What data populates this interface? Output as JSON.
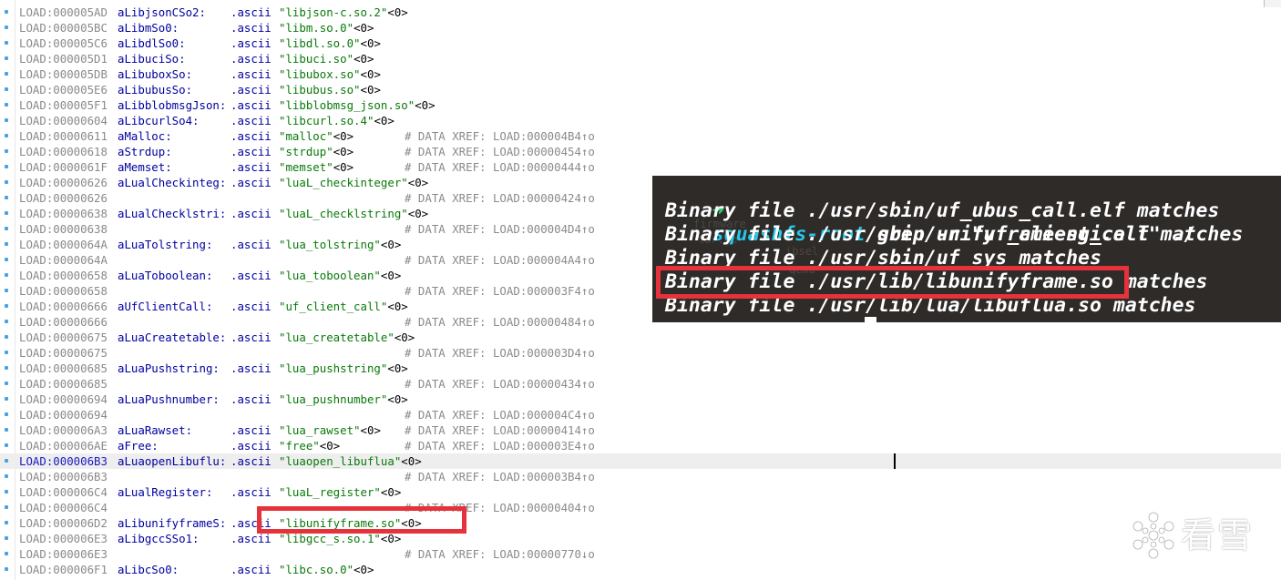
{
  "disassembly": {
    "lines": [
      {
        "addr": "LOAD:000005AD",
        "label": "aLibjsonCSo2:",
        "directive": ".ascii",
        "value": "\"libjson-c.so.2\"",
        "nul": "<0>",
        "comment": ""
      },
      {
        "addr": "LOAD:000005BC",
        "label": "aLibmSo0:",
        "directive": ".ascii",
        "value": "\"libm.so.0\"",
        "nul": "<0>",
        "comment": ""
      },
      {
        "addr": "LOAD:000005C6",
        "label": "aLibdlSo0:",
        "directive": ".ascii",
        "value": "\"libdl.so.0\"",
        "nul": "<0>",
        "comment": ""
      },
      {
        "addr": "LOAD:000005D1",
        "label": "aLibuciSo:",
        "directive": ".ascii",
        "value": "\"libuci.so\"",
        "nul": "<0>",
        "comment": ""
      },
      {
        "addr": "LOAD:000005DB",
        "label": "aLibuboxSo:",
        "directive": ".ascii",
        "value": "\"libubox.so\"",
        "nul": "<0>",
        "comment": ""
      },
      {
        "addr": "LOAD:000005E6",
        "label": "aLibubusSo:",
        "directive": ".ascii",
        "value": "\"libubus.so\"",
        "nul": "<0>",
        "comment": ""
      },
      {
        "addr": "LOAD:000005F1",
        "label": "aLibblobmsgJson:",
        "directive": ".ascii",
        "value": "\"libblobmsg_json.so\"",
        "nul": "<0>",
        "comment": ""
      },
      {
        "addr": "LOAD:00000604",
        "label": "aLibcurlSo4:",
        "directive": ".ascii",
        "value": "\"libcurl.so.4\"",
        "nul": "<0>",
        "comment": ""
      },
      {
        "addr": "LOAD:00000611",
        "label": "aMalloc:",
        "directive": ".ascii",
        "value": "\"malloc\"",
        "nul": "<0>",
        "comment": "# DATA XREF: LOAD:000004B4↑o"
      },
      {
        "addr": "LOAD:00000618",
        "label": "aStrdup:",
        "directive": ".ascii",
        "value": "\"strdup\"",
        "nul": "<0>",
        "comment": "# DATA XREF: LOAD:00000454↑o"
      },
      {
        "addr": "LOAD:0000061F",
        "label": "aMemset:",
        "directive": ".ascii",
        "value": "\"memset\"",
        "nul": "<0>",
        "comment": "# DATA XREF: LOAD:00000444↑o"
      },
      {
        "addr": "LOAD:00000626",
        "label": "aLualCheckinteg:",
        "directive": ".ascii",
        "value": "\"luaL_checkinteger\"",
        "nul": "<0>",
        "comment": ""
      },
      {
        "addr": "LOAD:00000626",
        "label": "",
        "directive": "",
        "value": "",
        "nul": "",
        "comment": "# DATA XREF: LOAD:00000424↑o"
      },
      {
        "addr": "LOAD:00000638",
        "label": "aLualChecklstri:",
        "directive": ".ascii",
        "value": "\"luaL_checklstring\"",
        "nul": "<0>",
        "comment": ""
      },
      {
        "addr": "LOAD:00000638",
        "label": "",
        "directive": "",
        "value": "",
        "nul": "",
        "comment": "# DATA XREF: LOAD:000004D4↑o"
      },
      {
        "addr": "LOAD:0000064A",
        "label": "aLuaTolstring:",
        "directive": ".ascii",
        "value": "\"lua_tolstring\"",
        "nul": "<0>",
        "comment": ""
      },
      {
        "addr": "LOAD:0000064A",
        "label": "",
        "directive": "",
        "value": "",
        "nul": "",
        "comment": "# DATA XREF: LOAD:000004A4↑o"
      },
      {
        "addr": "LOAD:00000658",
        "label": "aLuaToboolean:",
        "directive": ".ascii",
        "value": "\"lua_toboolean\"",
        "nul": "<0>",
        "comment": ""
      },
      {
        "addr": "LOAD:00000658",
        "label": "",
        "directive": "",
        "value": "",
        "nul": "",
        "comment": "# DATA XREF: LOAD:000003F4↑o"
      },
      {
        "addr": "LOAD:00000666",
        "label": "aUfClientCall:",
        "directive": ".ascii",
        "value": "\"uf_client_call\"",
        "nul": "<0>",
        "comment": ""
      },
      {
        "addr": "LOAD:00000666",
        "label": "",
        "directive": "",
        "value": "",
        "nul": "",
        "comment": "# DATA XREF: LOAD:00000484↑o"
      },
      {
        "addr": "LOAD:00000675",
        "label": "aLuaCreatetable:",
        "directive": ".ascii",
        "value": "\"lua_createtable\"",
        "nul": "<0>",
        "comment": ""
      },
      {
        "addr": "LOAD:00000675",
        "label": "",
        "directive": "",
        "value": "",
        "nul": "",
        "comment": "# DATA XREF: LOAD:000003D4↑o"
      },
      {
        "addr": "LOAD:00000685",
        "label": "aLuaPushstring:",
        "directive": ".ascii",
        "value": "\"lua_pushstring\"",
        "nul": "<0>",
        "comment": ""
      },
      {
        "addr": "LOAD:00000685",
        "label": "",
        "directive": "",
        "value": "",
        "nul": "",
        "comment": "# DATA XREF: LOAD:00000434↑o"
      },
      {
        "addr": "LOAD:00000694",
        "label": "aLuaPushnumber:",
        "directive": ".ascii",
        "value": "\"lua_pushnumber\"",
        "nul": "<0>",
        "comment": ""
      },
      {
        "addr": "LOAD:00000694",
        "label": "",
        "directive": "",
        "value": "",
        "nul": "",
        "comment": "# DATA XREF: LOAD:000004C4↑o"
      },
      {
        "addr": "LOAD:000006A3",
        "label": "aLuaRawset:",
        "directive": ".ascii",
        "value": "\"lua_rawset\"",
        "nul": "<0>",
        "comment": "# DATA XREF: LOAD:00000414↑o"
      },
      {
        "addr": "LOAD:000006AE",
        "label": "aFree:",
        "directive": ".ascii",
        "value": "\"free\"",
        "nul": "<0>",
        "comment": "# DATA XREF: LOAD:000003E4↑o"
      },
      {
        "addr": "LOAD:000006B3",
        "label": "aLuaopenLibuflu:",
        "directive": ".ascii",
        "value": "\"luaopen_libuflua\"",
        "nul": "<0>",
        "comment": ""
      },
      {
        "addr": "LOAD:000006B3",
        "label": "",
        "directive": "",
        "value": "",
        "nul": "",
        "comment": "# DATA XREF: LOAD:000003B4↑o"
      },
      {
        "addr": "LOAD:000006C4",
        "label": "aLualRegister:",
        "directive": ".ascii",
        "value": "\"luaL_register\"",
        "nul": "<0>",
        "comment": ""
      },
      {
        "addr": "LOAD:000006C4",
        "label": "",
        "directive": "",
        "value": "",
        "nul": "",
        "comment": "# DATA XREF: LOAD:00000404↑o"
      },
      {
        "addr": "LOAD:000006D2",
        "label": "aLibunifyframeS:",
        "directive": ".ascii",
        "value": "\"libunifyframe.so\"",
        "nul": "<0>",
        "comment": ""
      },
      {
        "addr": "LOAD:000006E3",
        "label": "aLibgccSSo1:",
        "directive": ".ascii",
        "value": "\"libgcc_s.so.1\"",
        "nul": "<0>",
        "comment": ""
      },
      {
        "addr": "LOAD:000006E3",
        "label": "",
        "directive": "",
        "value": "",
        "nul": "",
        "comment": "# DATA XREF: LOAD:00000770↓o"
      },
      {
        "addr": "LOAD:000006F1",
        "label": "aLibcSo0:",
        "directive": ".ascii",
        "value": "\"libc.so.0\"",
        "nul": "<0>",
        "comment": ""
      }
    ],
    "current_line_index": 29
  },
  "terminal": {
    "prompt_arrow": "➜",
    "cwd": "squashfs-root",
    "command": " grep -r \"uf_client_call\" ./",
    "output": [
      "Binary file ./usr/sbin/uf_ubus_call.elf matches",
      "Binary file ./usr/sbin/unifyframe-sgi.elf matches",
      "Binary file ./usr/sbin/uf_sys matches",
      "Binary file ./usr/lib/libunifyframe.so matches",
      "Binary file ./usr/lib/lua/libuflua.so matches"
    ],
    "ghost_text": [
      "firmware",
      "tar.gb",
      "ibsel",
      "qemu"
    ]
  },
  "watermark": {
    "icon": "snowflake-icon",
    "text": "看雪"
  },
  "colors": {
    "highlight_box": "#e6323b",
    "terminal_bg": "#2e2b29",
    "prompt_arrow": "#22d36a",
    "prompt_cwd": "#26c6e8"
  }
}
